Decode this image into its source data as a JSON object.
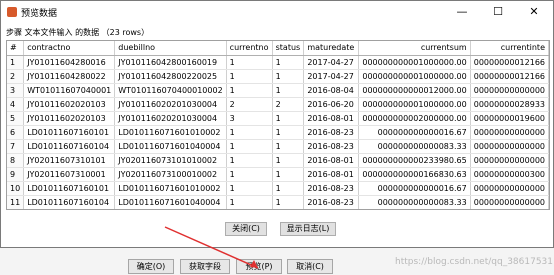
{
  "dialog": {
    "title": "预览数据",
    "step_label": "步骤 文本文件输入 的数据 （23 rows）",
    "columns": [
      "#",
      "contractno",
      "duebillno",
      "currentno",
      "status",
      "maturedate",
      "currentsum",
      "currentinte"
    ],
    "rows": [
      [
        "1",
        "JY01011604280016",
        "JY010116042800160019",
        "1",
        "1",
        "2017-04-27",
        "000000000001000000.00",
        "00000000012166"
      ],
      [
        "2",
        "JY01011604280022",
        "JY010116042800220025",
        "1",
        "1",
        "2017-04-27",
        "000000000001000000.00",
        "00000000012166"
      ],
      [
        "3",
        "WT01011607040001",
        "WT010116070400010002",
        "1",
        "1",
        "2016-08-04",
        "000000000000012000.00",
        "00000000000000"
      ],
      [
        "4",
        "JY01011602020103",
        "JY010116020201030004",
        "2",
        "2",
        "2016-06-20",
        "000000000001000000.00",
        "00000000028933"
      ],
      [
        "5",
        "JY01011602020103",
        "JY010116020201030004",
        "3",
        "1",
        "2016-08-01",
        "000000000002000000.00",
        "00000000019600"
      ],
      [
        "6",
        "LD01011607160101",
        "LD010116071601010002",
        "1",
        "1",
        "2016-08-23",
        "000000000000016.67",
        "00000000000000"
      ],
      [
        "7",
        "LD01011607160104",
        "LD010116071601040004",
        "1",
        "1",
        "2016-08-23",
        "000000000000083.33",
        "00000000000000"
      ],
      [
        "8",
        "JY02011607310101",
        "JY020116073101010002",
        "1",
        "1",
        "2016-08-01",
        "000000000000233980.65",
        "00000000000000"
      ],
      [
        "9",
        "JY02011607310001",
        "JY020116073100010002",
        "1",
        "1",
        "2016-08-01",
        "000000000000166830.63",
        "00000000000300"
      ],
      [
        "10",
        "LD01011607160101",
        "LD010116071601010002",
        "1",
        "1",
        "2016-08-23",
        "000000000000016.67",
        "00000000000000"
      ],
      [
        "11",
        "LD01011607160104",
        "LD010116071601040004",
        "1",
        "1",
        "2016-08-23",
        "000000000000083.33",
        "00000000000000"
      ]
    ],
    "close_button": "关闭(C)",
    "show_log_button": "显示日志(L)"
  },
  "background": {
    "ok_button": "确定(O)",
    "get_fields_button": "获取字段",
    "preview_button": "预览(P)",
    "cancel_button": "取消(C)"
  },
  "window_controls": {
    "minimize": "—",
    "maximize": "☐",
    "close": "✕"
  },
  "watermark": "https://blog.csdn.net/qq_38617531",
  "colors": {
    "arrow": "#e03030",
    "title_icon": "#d75a2b"
  }
}
